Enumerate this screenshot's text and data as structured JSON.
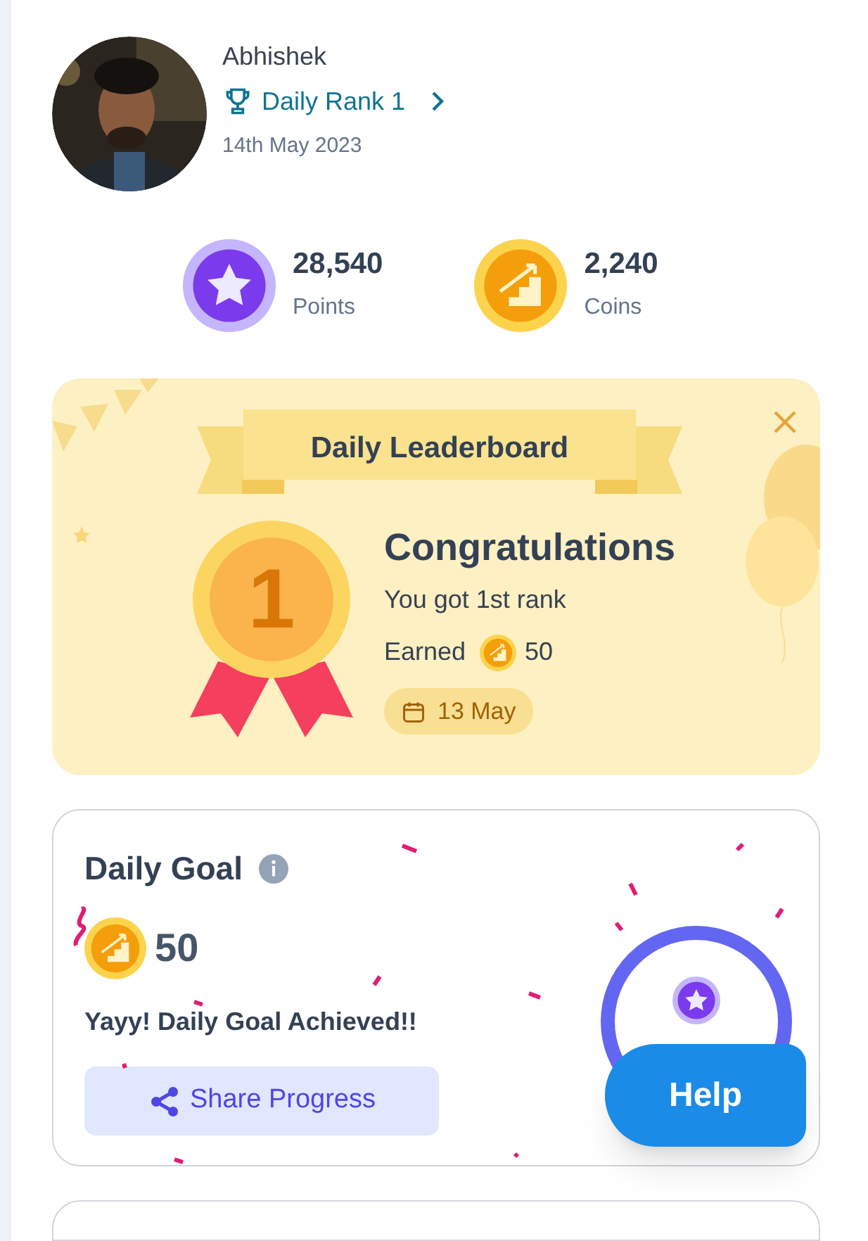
{
  "profile": {
    "name": "Abhishek",
    "rank_link": "Daily Rank 1",
    "date": "14th May 2023"
  },
  "stats": [
    {
      "kind": "points",
      "value": "28,540",
      "label": "Points"
    },
    {
      "kind": "coins",
      "value": "2,240",
      "label": "Coins"
    }
  ],
  "leaderboard_card": {
    "banner": "Daily Leaderboard",
    "title": "Congratulations",
    "message": "You got 1st rank",
    "earned_label": "Earned",
    "earned_amount": "50",
    "date": "13 May",
    "medal_number": "1"
  },
  "daily_goal": {
    "title": "Daily Goal",
    "coins": "50",
    "message": "Yayy! Daily Goal Achieved!!",
    "share_button": "Share Progress"
  },
  "help_button": "Help"
}
